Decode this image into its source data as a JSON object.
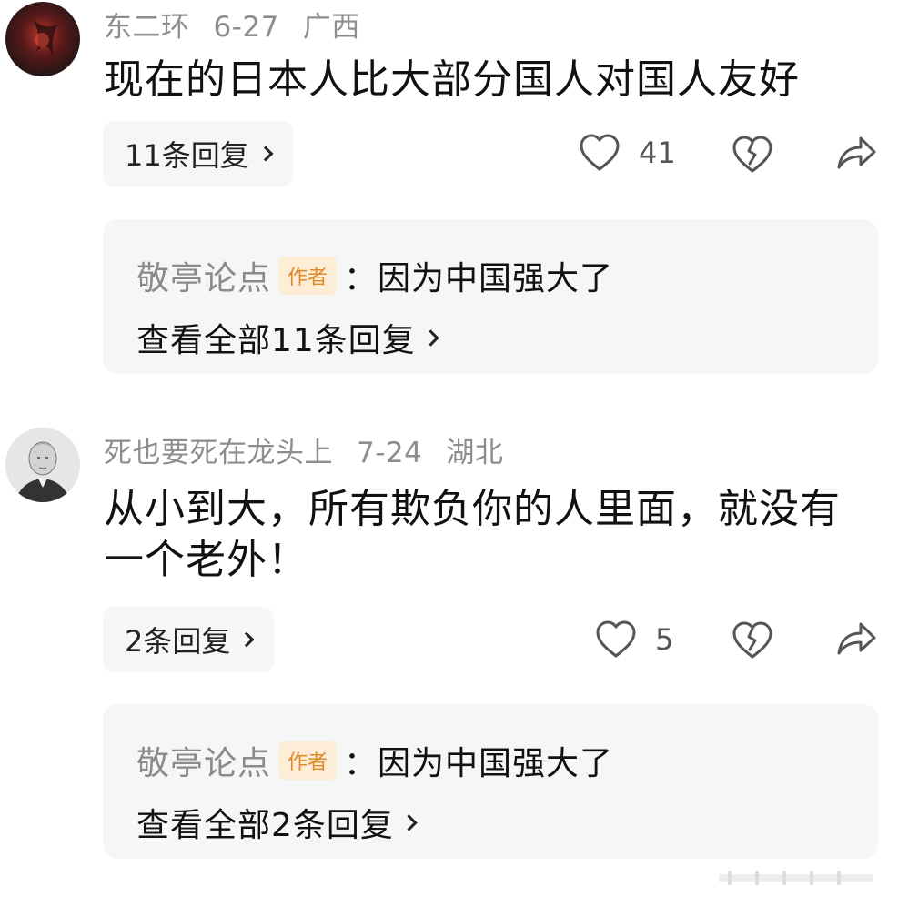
{
  "comments": [
    {
      "username": "东二环",
      "date": "6-27",
      "location": "广西",
      "text": "现在的日本人比大部分国人对国人友好",
      "replies_label": "11条回复",
      "likes": "41",
      "sub_reply": {
        "author": "敬亭论点",
        "badge": "作者",
        "text": "：因为中国强大了",
        "view_all": "查看全部11条回复"
      }
    },
    {
      "username": "死也要死在龙头上",
      "date": "7-24",
      "location": "湖北",
      "text": "从小到大，所有欺负你的人里面，就没有一个老外！",
      "replies_label": "2条回复",
      "likes": "5",
      "sub_reply": {
        "author": "敬亭论点",
        "badge": "作者",
        "text": "：因为中国强大了",
        "view_all": "查看全部2条回复"
      }
    }
  ],
  "icons": {
    "like": "heart-outline-icon",
    "dislike": "broken-heart-icon",
    "share": "share-arrow-icon",
    "chevron": "chevron-right-icon"
  },
  "colors": {
    "meta_gray": "#8d8d8d",
    "badge_bg": "#fdecd6",
    "badge_text": "#e08b2a",
    "panel_bg": "#f6f6f6"
  }
}
